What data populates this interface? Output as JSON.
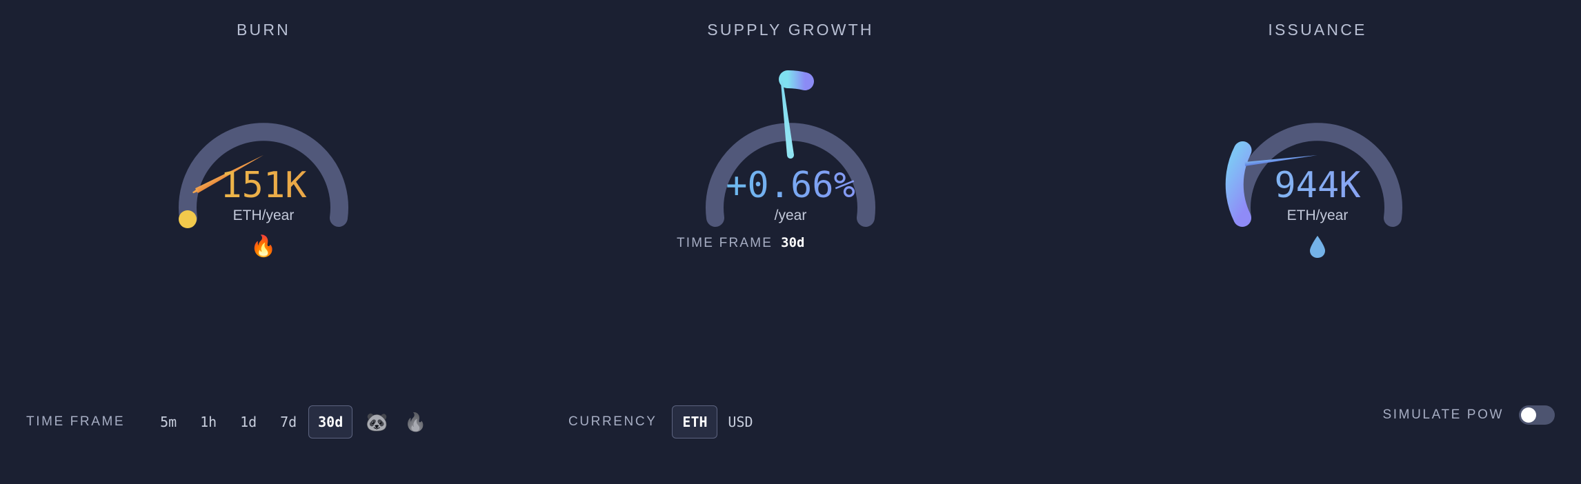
{
  "theme": {
    "background": "#1b2032",
    "track": "#51587a",
    "text_muted": "#a7aec4",
    "text_bright": "#ffffff",
    "burn_accent": "#eeaa4a",
    "burn_cap": "#f2c94c",
    "supply_accent_from": "#7fe0f0",
    "supply_accent_to": "#8b8bf5",
    "issuance_accent_from": "#7fc4f5",
    "issuance_accent_to": "#8f8bf7"
  },
  "panels": [
    {
      "key": "burn",
      "title": "BURN",
      "value": "151K",
      "unit": "ETH/year",
      "emoji_name": "fire-emoji",
      "emoji": "🔥"
    },
    {
      "key": "supply_growth",
      "title": "SUPPLY GROWTH",
      "value": "+0.66%",
      "unit": "/year",
      "sub_label": "TIME FRAME",
      "sub_value": "30d"
    },
    {
      "key": "issuance",
      "title": "ISSUANCE",
      "value": "944K",
      "unit": "ETH/year",
      "emoji_name": "droplet-icon",
      "emoji": "💧"
    }
  ],
  "chart_data": [
    {
      "type": "gauge",
      "title": "BURN",
      "value": 151000,
      "display_value": "151K",
      "unit": "ETH/year",
      "needle_angle_deg": -118,
      "arc_fill_fraction": 0.0,
      "range_start_deg": -130,
      "range_end_deg": 130,
      "track_color": "#51587a",
      "accent_color": "#eeaa4a"
    },
    {
      "type": "gauge",
      "title": "SUPPLY GROWTH",
      "value": 0.66,
      "display_value": "+0.66%",
      "unit": "/year",
      "needle_angle_deg": -7,
      "arc_marker_deg": -5,
      "range_start_deg": -130,
      "range_end_deg": 130,
      "track_color": "#51587a",
      "accent_color": "#8b8bf5"
    },
    {
      "type": "gauge",
      "title": "ISSUANCE",
      "value": 944000,
      "display_value": "944K",
      "unit": "ETH/year",
      "needle_angle_deg": -97,
      "arc_fill_fraction": 0.12,
      "range_start_deg": -130,
      "range_end_deg": 130,
      "track_color": "#51587a",
      "accent_color": "#7fc4f5"
    }
  ],
  "controls": {
    "time_frame": {
      "label": "TIME FRAME",
      "options": [
        "5m",
        "1h",
        "1d",
        "7d",
        "30d"
      ],
      "selected": "30d",
      "icons": [
        {
          "name": "panda-icon",
          "glyph": "🐼"
        },
        {
          "name": "fire-icon",
          "glyph": "🔥"
        }
      ]
    },
    "currency": {
      "label": "CURRENCY",
      "options": [
        "ETH",
        "USD"
      ],
      "selected": "ETH"
    },
    "simulate_pow": {
      "label": "SIMULATE PoW",
      "enabled": false
    }
  }
}
